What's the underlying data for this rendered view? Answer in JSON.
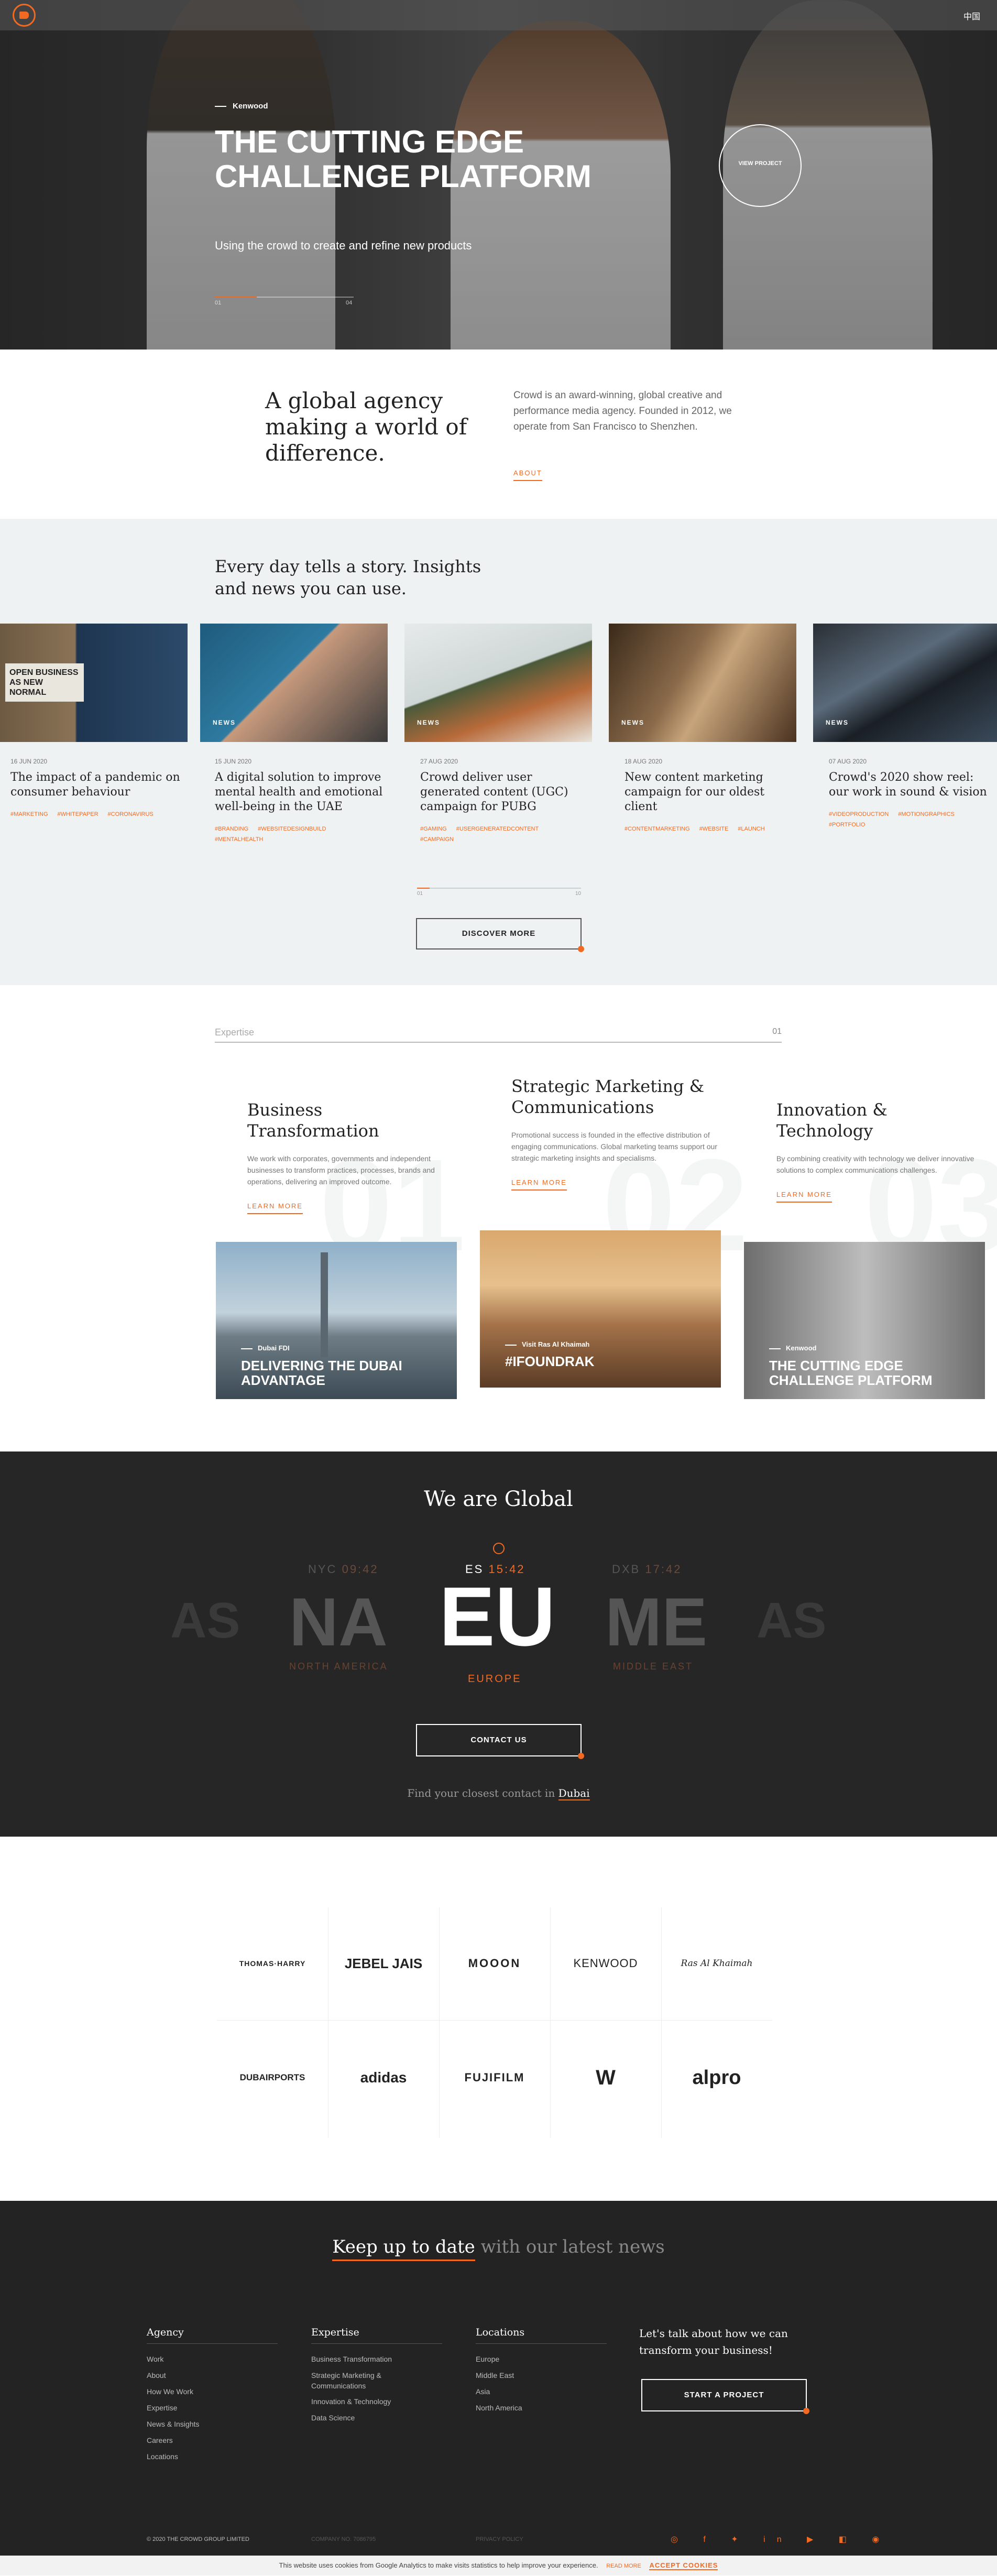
{
  "header": {
    "lang": "中国"
  },
  "hero": {
    "client": "Kenwood",
    "title": "THE CUTTING EDGE CHALLENGE PLATFORM",
    "subtitle": "Using the crowd to create and refine new products",
    "index_start": "01",
    "index_end": "04",
    "view_label": "VIEW PROJECT"
  },
  "intro": {
    "heading": "A global agency making a world of difference.",
    "text": "Crowd is an award-winning, global creative and performance media agency. Founded in 2012, we operate from San Francisco to Shenzhen.",
    "link": "ABOUT"
  },
  "news": {
    "heading": "Every day tells a story. Insights and news you can use.",
    "cards": [
      {
        "tag": "",
        "date": "16 JUN 2020",
        "title": "The impact of a pandemic on consumer behaviour",
        "tags": [
          "#MARKETING",
          "#WHITEPAPER",
          "#CORONAVIRUS"
        ],
        "sign": "OPEN BUSINESS AS NEW NORMAL"
      },
      {
        "tag": "NEWS",
        "date": "15 JUN 2020",
        "title": "A digital solution to improve mental health and emotional well-being in the UAE",
        "tags": [
          "#BRANDING",
          "#WEBSITEDESIGNBUILD",
          "#MENTALHEALTH"
        ],
        "sign": ""
      },
      {
        "tag": "NEWS",
        "date": "27 AUG 2020",
        "title": "Crowd deliver user generated content (UGC) campaign for PUBG",
        "tags": [
          "#GAMING",
          "#USERGENERATEDCONTENT",
          "#CAMPAIGN"
        ],
        "sign": ""
      },
      {
        "tag": "NEWS",
        "date": "18 AUG 2020",
        "title": "New content marketing campaign for our oldest client",
        "tags": [
          "#CONTENTMARKETING",
          "#WEBSITE",
          "#LAUNCH"
        ],
        "sign": ""
      },
      {
        "tag": "NEWS",
        "date": "07 AUG 2020",
        "title": "Crowd's 2020 show reel: our work in sound & vision",
        "tags": [
          "#VIDEOPRODUCTION",
          "#MOTIONGRAPHICS",
          "#PORTFOLIO"
        ],
        "sign": ""
      }
    ],
    "slider_start": "01",
    "slider_end": "10",
    "button": "DISCOVER MORE"
  },
  "expertise": {
    "label": "Expertise",
    "index": "01",
    "columns": [
      {
        "num": "01",
        "title": "Business Transformation",
        "text": "We work with corporates, governments and independent businesses to transform practices, processes, brands and operations, delivering an improved outcome.",
        "link": "LEARN MORE",
        "client": "Dubai FDI",
        "project": "DELIVERING THE DUBAI ADVANTAGE"
      },
      {
        "num": "02",
        "title": "Strategic Marketing & Communications",
        "text": "Promotional success is founded in the effective distribution of engaging communications. Global marketing teams support our strategic marketing insights and specialisms.",
        "link": "LEARN MORE",
        "client": "Visit Ras Al Khaimah",
        "project": "#IFOUNDRAK"
      },
      {
        "num": "03",
        "title": "Innovation & Technology",
        "text": "By combining creativity with technology we deliver innovative solutions to complex communications challenges.",
        "link": "LEARN MORE",
        "client": "Kenwood",
        "project": "THE CUTTING EDGE CHALLENGE PLATFORM"
      }
    ]
  },
  "global": {
    "heading": "We are Global",
    "regions": [
      {
        "code": "AS",
        "city": "",
        "time": "",
        "name": ""
      },
      {
        "code": "NA",
        "city": "NYC",
        "time": "09:42",
        "name": "NORTH AMERICA"
      },
      {
        "code": "EU",
        "city": "ES",
        "time": "15:42",
        "name": "EUROPE"
      },
      {
        "code": "ME",
        "city": "DXB",
        "time": "17:42",
        "name": "MIDDLE EAST"
      },
      {
        "code": "AS",
        "city": "",
        "time": "",
        "name": ""
      }
    ],
    "button": "CONTACT US",
    "find_text": "Find your closest contact in",
    "find_city": "Dubai"
  },
  "clients": [
    "THOMAS·HARRY",
    "JEBEL JAIS",
    "MOOON",
    "KENWOOD",
    "Ras Al Khaimah",
    "DUBAIRPORTS",
    "adidas",
    "FUJIFILM",
    "W",
    "alpro"
  ],
  "footer": {
    "keep_a": "Keep up to date",
    "keep_b": "with our latest news",
    "agency": {
      "title": "Agency",
      "items": [
        "Work",
        "About",
        "How We Work",
        "Expertise",
        "News & Insights",
        "Careers",
        "Locations"
      ]
    },
    "expertise": {
      "title": "Expertise",
      "items": [
        "Business Transformation",
        "Strategic Marketing & Communications",
        "Innovation & Technology",
        "Data Science"
      ]
    },
    "locations": {
      "title": "Locations",
      "items": [
        "Europe",
        "Middle East",
        "Asia",
        "North America"
      ]
    },
    "cta": "Let's talk about how we can transform your business!",
    "button": "START A PROJECT",
    "copyright": "© 2020 THE CROWD GROUP LIMITED",
    "company": "COMPANY NO. 7086795",
    "privacy": "PRIVACY POLICY",
    "social": "◎ f ✦ in ▶ ◧ ◉"
  },
  "cookie": {
    "text": "This website uses cookies from Google Analytics to make visits statistics to help improve your experience.",
    "read": "READ MORE",
    "accept": "ACCEPT COOKIES"
  },
  "colors": {
    "accent": "#f26a21",
    "dark": "#262626",
    "light_bg": "#eef2f2"
  }
}
